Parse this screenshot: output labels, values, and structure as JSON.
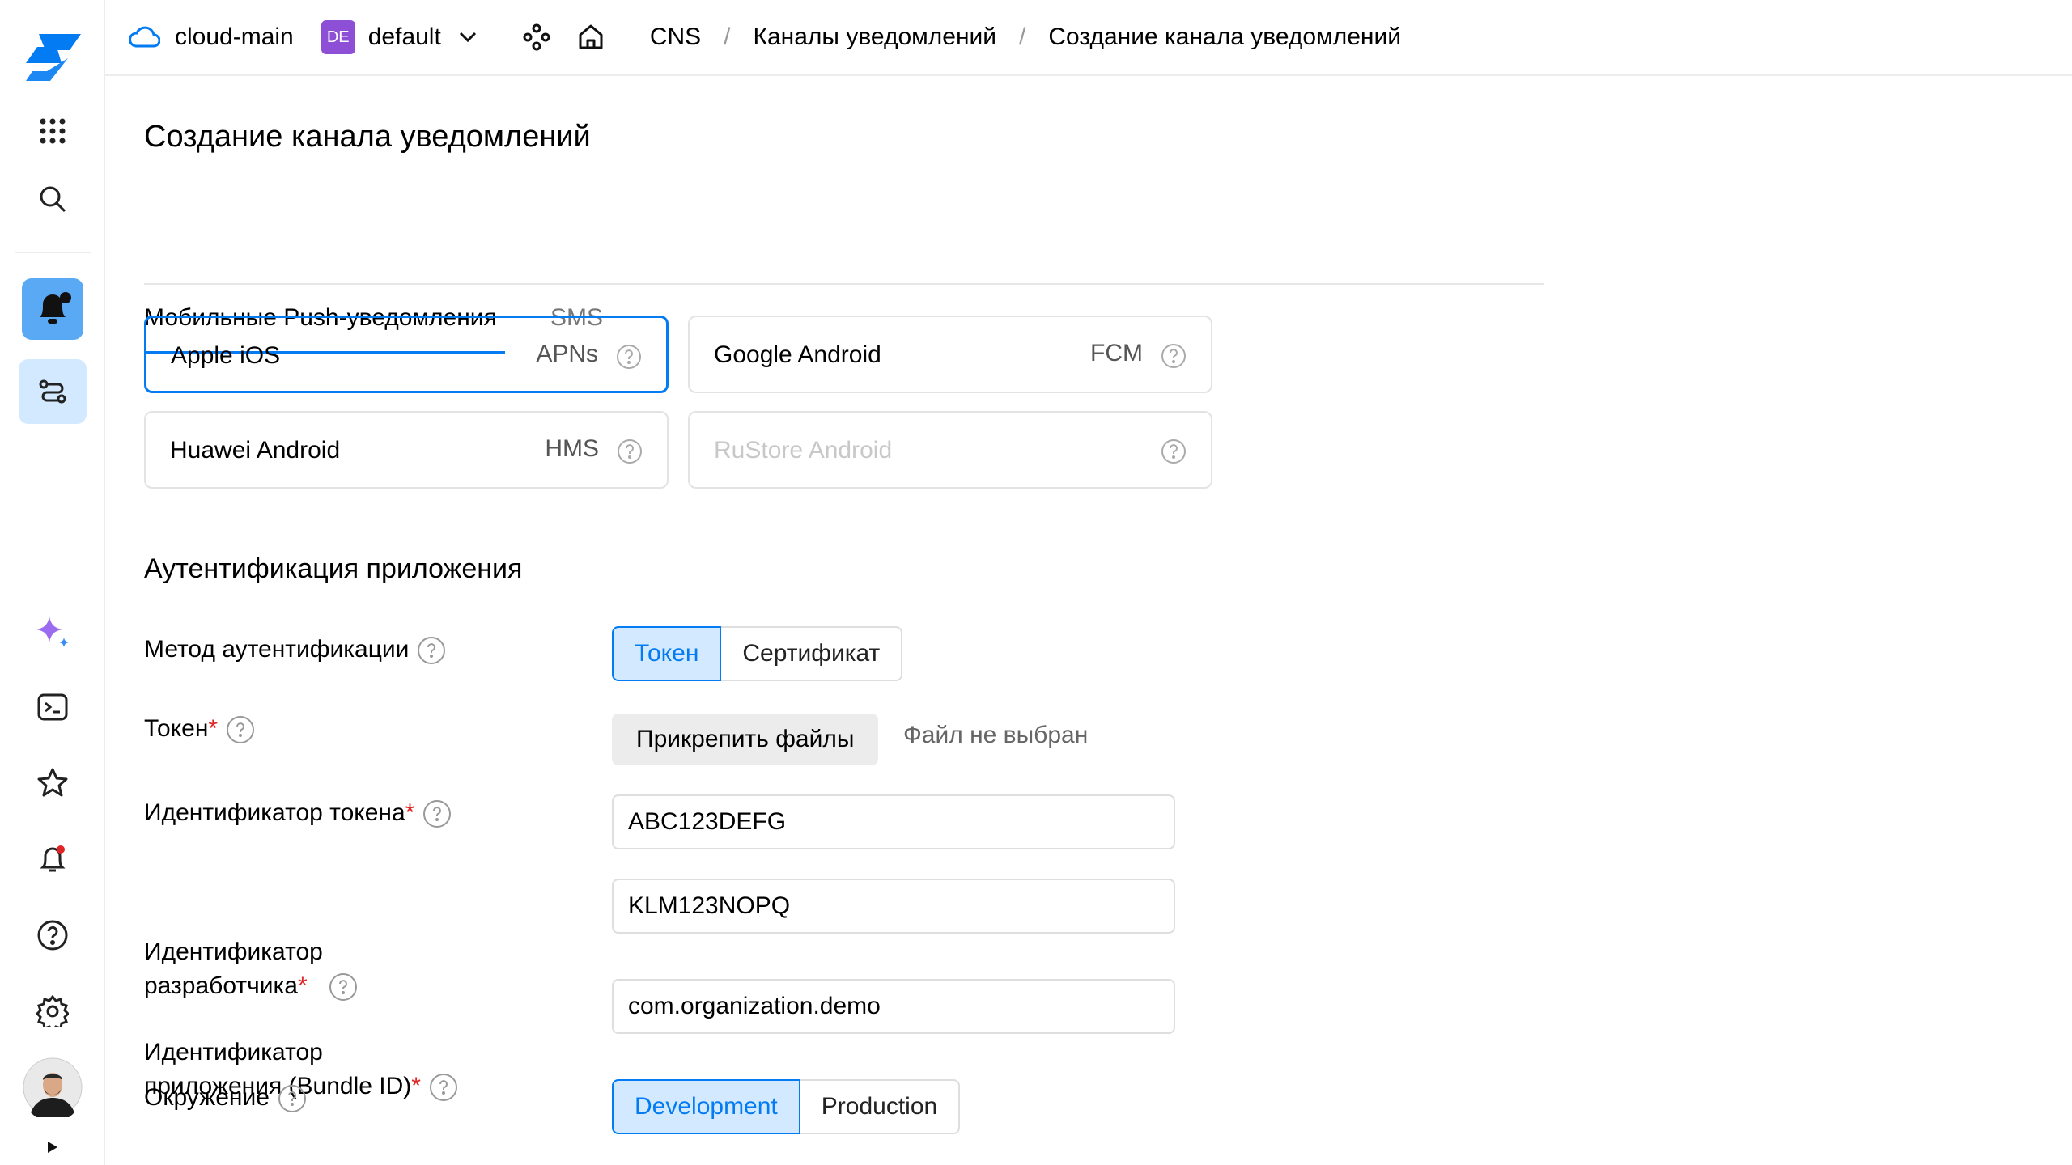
{
  "topbar": {
    "cloud": "cloud-main",
    "folder_badge": "DE",
    "folder": "default",
    "crumb_1": "CNS",
    "crumb_2": "Каналы уведомлений",
    "crumb_3": "Создание канала уведомлений"
  },
  "page": {
    "title": "Создание канала уведомлений"
  },
  "tabs": {
    "push": "Мобильные Push-уведомления",
    "sms": "SMS"
  },
  "platforms": {
    "ios": {
      "name": "Apple iOS",
      "code": "APNs"
    },
    "android": {
      "name": "Google Android",
      "code": "FCM"
    },
    "huawei": {
      "name": "Huawei Android",
      "code": "HMS"
    },
    "rustore": {
      "name": "RuStore Android",
      "code": ""
    }
  },
  "auth": {
    "section_title": "Аутентификация приложения",
    "method_label": "Метод аутентификации",
    "method_token": "Токен",
    "method_cert": "Сертификат",
    "token_label": "Токен",
    "attach_label": "Прикрепить файлы",
    "no_file": "Файл не выбран",
    "key_id_label": "Идентификатор токена",
    "key_id_value": "ABC123DEFG",
    "team_id_label_1": "Идентификатор",
    "team_id_label_2": "разработчика",
    "team_id_value": "KLM123NOPQ",
    "bundle_label_1": "Идентификатор",
    "bundle_label_2": "приложения (Bundle ID)",
    "bundle_value": "com.organization.demo",
    "env_label": "Окружение",
    "env_dev": "Development",
    "env_prod": "Production"
  },
  "colors": {
    "accent": "#027bf3",
    "accent_bg": "#d3e9ff",
    "required": "#e02424",
    "badge": "#8c4fd6"
  }
}
